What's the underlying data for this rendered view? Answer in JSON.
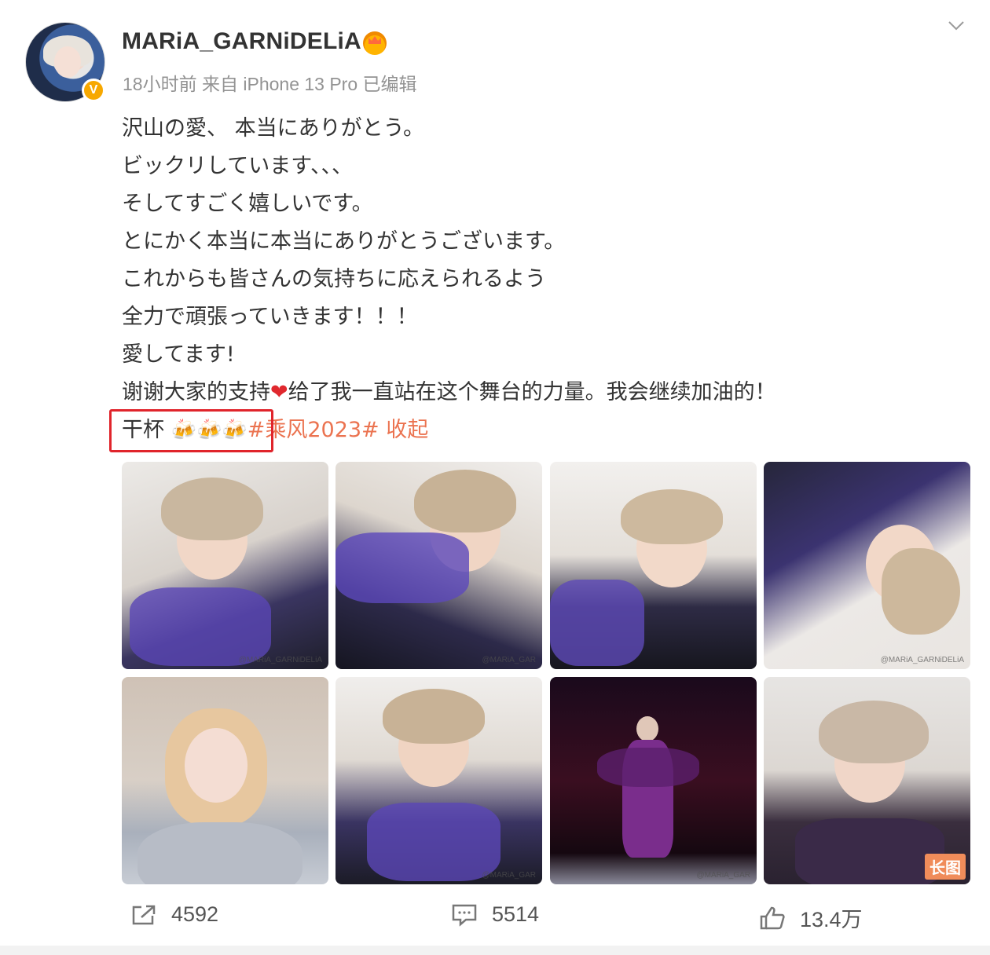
{
  "post": {
    "username": "MARiA_GARNiDELiA",
    "meta": "18小时前 来自 iPhone 13 Pro 已编辑",
    "lines": [
      "沢山の愛、 本当にありがとう。",
      "ビックリしています、、、",
      "そしてすごく嬉しいです。",
      "とにかく本当に本当にありがとうございます。",
      "これからも皆さんの気持ちに応えられるよう",
      "全力で頑張っていきます！！！",
      "愛してます!"
    ],
    "thanks_before": "谢谢大家的支持",
    "thanks_after": "给了我一直站在这个舞台的力量。我会继续加油的！",
    "cheers": "干杯",
    "hashtag": "#乘风2023#",
    "collapse": "收起"
  },
  "photos": {
    "long_badge": "长图",
    "watermarks": [
      "@MARiA_GARNiDELiA",
      "@MARiA_GAR",
      "@MARiA_GARNiDELiA",
      "@MARiA_GAR",
      "@MARiA_GAR"
    ]
  },
  "actions": {
    "share_count": "4592",
    "comment_count": "5514",
    "like_count": "13.4万"
  },
  "colors": {
    "accent": "#eb7350",
    "highlight_box": "#e0242b",
    "verified": "#f7a800"
  },
  "icons": [
    "avatar",
    "verified-badge-icon",
    "crown-icon",
    "chevron-down-icon",
    "heart-emoji-icon",
    "beer-mug-icon",
    "share-icon",
    "comment-icon",
    "like-icon"
  ]
}
